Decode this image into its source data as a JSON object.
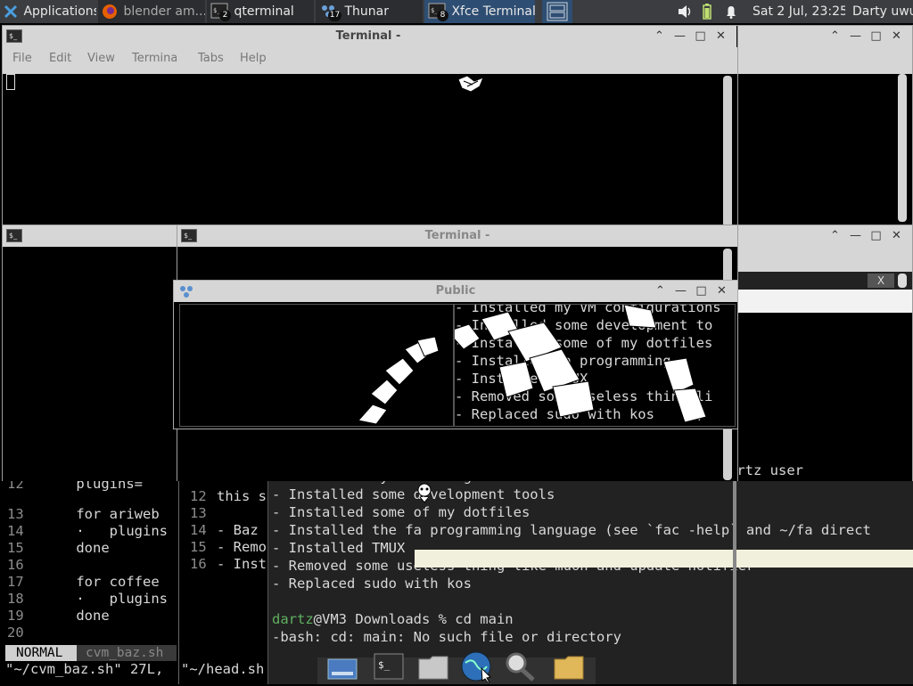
{
  "panel": {
    "applications": "Applications",
    "tasks": [
      {
        "label": "blender am...",
        "badge": ""
      },
      {
        "label": "qterminal",
        "badge": "2"
      },
      {
        "label": "Thunar",
        "badge": "17"
      },
      {
        "label": "Xfce Terminal",
        "badge": "8"
      }
    ],
    "clock": "Sat  2 Jul, 23:25",
    "user": "Darty uwu"
  },
  "windows": {
    "terminal_top": {
      "title": "Terminal -",
      "menu": [
        "File",
        "Edit",
        "View",
        "Terminal",
        "Tabs",
        "Help"
      ]
    },
    "terminal_mid": {
      "title": "Terminal -"
    },
    "public": {
      "title": "Public"
    },
    "tab_close": "X"
  },
  "terminal_text": {
    "public_right_lines": [
      "- Installed my VM configurations",
      "- Installed some development to",
      "- Installed some of my dotfiles",
      "- Installed fa programming",
      "- Installed TMUX",
      "- Removed some useless thing li",
      "- Replaced sudo with kos     )"
    ],
    "right_partial": "artz user",
    "main_lines": [
      "- Installed my VM configurations",
      "- Installed some development tools",
      "- Installed some of my dotfiles",
      "- Installed the fa programming language (see `fac -help` and ~/fa direct",
      "- Installed TMUX",
      "- Removed some useless thing like muon and update notifier",
      "- Replaced sudo with kos",
      "",
      "@VM3 Downloads % cd main",
      "-bash: cd: main: No such file or directory"
    ],
    "prompt_user": "dartz"
  },
  "vim_left": {
    "lines": [
      {
        "num": "12",
        "text": "    plugins="
      },
      {
        "num": "13",
        "text": "    for ariweb"
      },
      {
        "num": "14",
        "text": "    ·   plugins"
      },
      {
        "num": "15",
        "text": "    done"
      },
      {
        "num": "16",
        "text": ""
      },
      {
        "num": "17",
        "text": "    for coffee"
      },
      {
        "num": "18",
        "text": "    ·   plugins"
      },
      {
        "num": "19",
        "text": "    done"
      },
      {
        "num": "20",
        "text": ""
      }
    ],
    "mode": "NORMAL",
    "file": "cvm_baz.sh",
    "status": "\"~/cvm_baz.sh\" 27L,"
  },
  "vim_mid": {
    "lines": [
      {
        "num": "12",
        "text": "this s"
      },
      {
        "num": "13",
        "text": ""
      },
      {
        "num": "14",
        "text": "- Baz"
      },
      {
        "num": "15",
        "text": "- Remo"
      },
      {
        "num": "16",
        "text": "- Inst"
      }
    ],
    "status": "\"~/head.sh"
  },
  "colors": {
    "panel_bg": "#3b3d40",
    "active_task": "#2e4d72",
    "titlebar": "#d6d6d6",
    "terminal_bg": "#000000",
    "highlight": "#f0f0dc",
    "vim_mode_bg": "#d0d0d0"
  },
  "icons": [
    "xfce-logo-icon",
    "firefox-icon",
    "terminal-icon",
    "thunar-icon",
    "volume-icon",
    "battery-icon",
    "bell-icon",
    "drive-icon",
    "folder-icon",
    "globe-icon",
    "magnifier-icon"
  ]
}
